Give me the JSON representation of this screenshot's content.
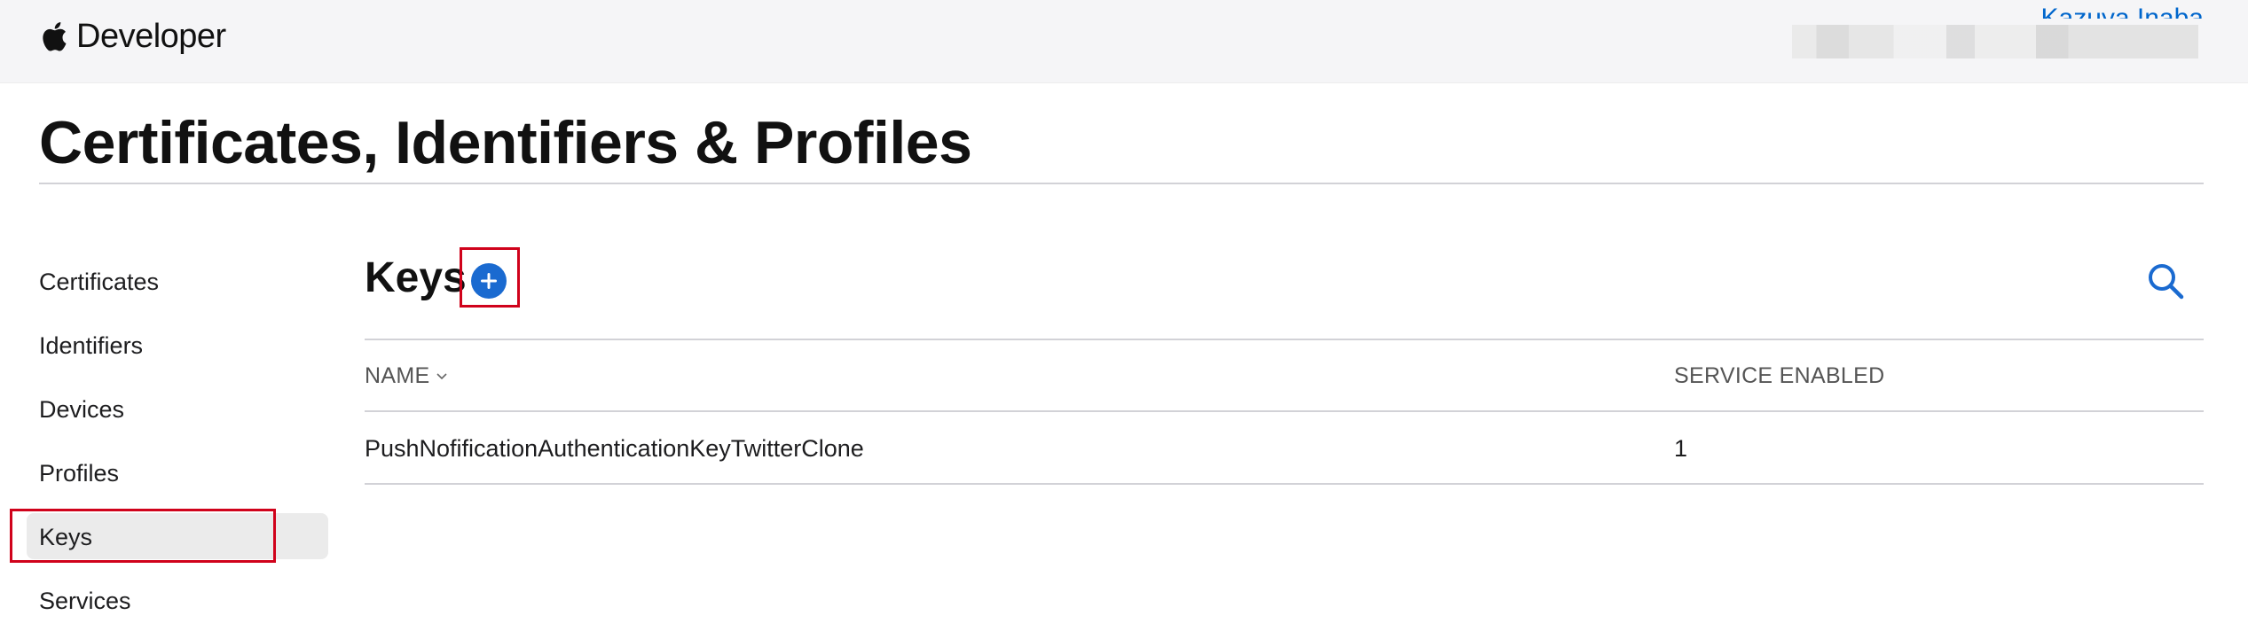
{
  "header": {
    "brand": "Developer",
    "account_name": "Kazuya Inaba"
  },
  "page": {
    "title": "Certificates, Identifiers & Profiles"
  },
  "sidebar": {
    "items": [
      {
        "label": "Certificates"
      },
      {
        "label": "Identifiers"
      },
      {
        "label": "Devices"
      },
      {
        "label": "Profiles"
      },
      {
        "label": "Keys"
      },
      {
        "label": "Services"
      }
    ],
    "selected": "Keys"
  },
  "keys": {
    "title": "Keys",
    "add_icon": "plus-circle-icon",
    "search_icon": "search-icon"
  },
  "table": {
    "columns": [
      "NAME",
      "SERVICE ENABLED"
    ],
    "rows": [
      {
        "name": "PushNofificationAuthenticationKeyTwitterClone",
        "service_enabled": "1"
      }
    ]
  },
  "colors": {
    "accent": "#0066cc",
    "add_button": "#1a6ad0",
    "highlight_box": "#d0021b",
    "selected_bg": "#ebebeb"
  }
}
